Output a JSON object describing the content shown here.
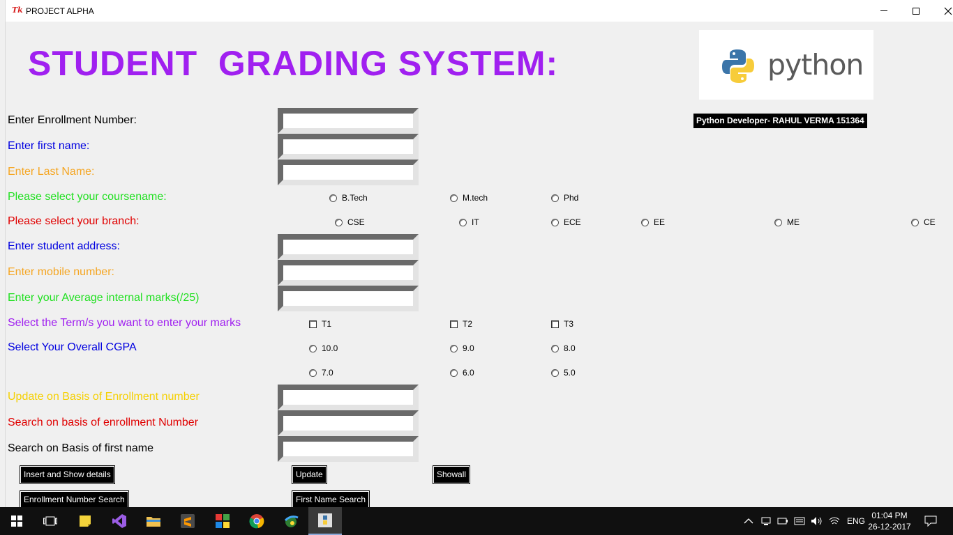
{
  "window": {
    "icon_text": "Tk",
    "title": "PROJECT ALPHA",
    "minimize": "–",
    "maximize": "□",
    "close": "✕"
  },
  "heading": "STUDENT  GRADING SYSTEM:",
  "logo": {
    "word": "python"
  },
  "developer_badge": "Python Developer- RAHUL VERMA 151364",
  "labels": {
    "enrollment": "Enter Enrollment Number:",
    "first_name": "Enter first name:",
    "last_name": "Enter Last Name:",
    "course": "Please select your coursename:",
    "branch": "Please select your branch:",
    "address": "Enter student address:",
    "mobile": "Enter mobile number:",
    "internal": "Enter your Average internal marks(/25)",
    "terms": "Select the Term/s you want to enter your marks",
    "cgpa": "Select Your Overall CGPA",
    "update_by_enrollment": "Update on Basis of Enrollment number",
    "search_by_enrollment": "Search on basis of enrollment Number",
    "search_by_first_name": "Search on Basis of first name"
  },
  "label_colors": {
    "black": "#000000",
    "blue": "#0000e0",
    "orange": "#f5a623",
    "green": "#22e022",
    "red": "#e00000",
    "purple": "#a020f0",
    "yellow": "#f5d000"
  },
  "fields": {
    "enrollment": "",
    "first_name": "",
    "last_name": "",
    "address": "",
    "mobile": "",
    "internal": "",
    "update_enrollment": "",
    "search_enrollment": "",
    "search_first_name": ""
  },
  "courses": [
    "B.Tech",
    "M.tech",
    "Phd"
  ],
  "branches": [
    "CSE",
    "IT",
    "ECE",
    "EE",
    "ME",
    "CE"
  ],
  "terms": [
    "T1",
    "T2",
    "T3"
  ],
  "cgpa_row1": [
    "10.0",
    "9.0",
    "8.0"
  ],
  "cgpa_row2": [
    "7.0",
    "6.0",
    "5.0"
  ],
  "buttons": {
    "insert": "Insert and Show details",
    "update": "Update",
    "showall": "Showall",
    "enrollment_search": "Enrollment Number Search",
    "first_name_search": "First Name Search"
  },
  "taskbar": {
    "apps": [
      "start-icon",
      "task-view-icon",
      "sticky-notes-icon",
      "visual-studio-icon",
      "file-explorer-icon",
      "sublime-text-icon",
      "windows-store-icon",
      "chrome-icon",
      "network-app-icon",
      "python-idle-icon"
    ],
    "language": "ENG",
    "time": "01:04 PM",
    "date": "26-12-2017"
  }
}
